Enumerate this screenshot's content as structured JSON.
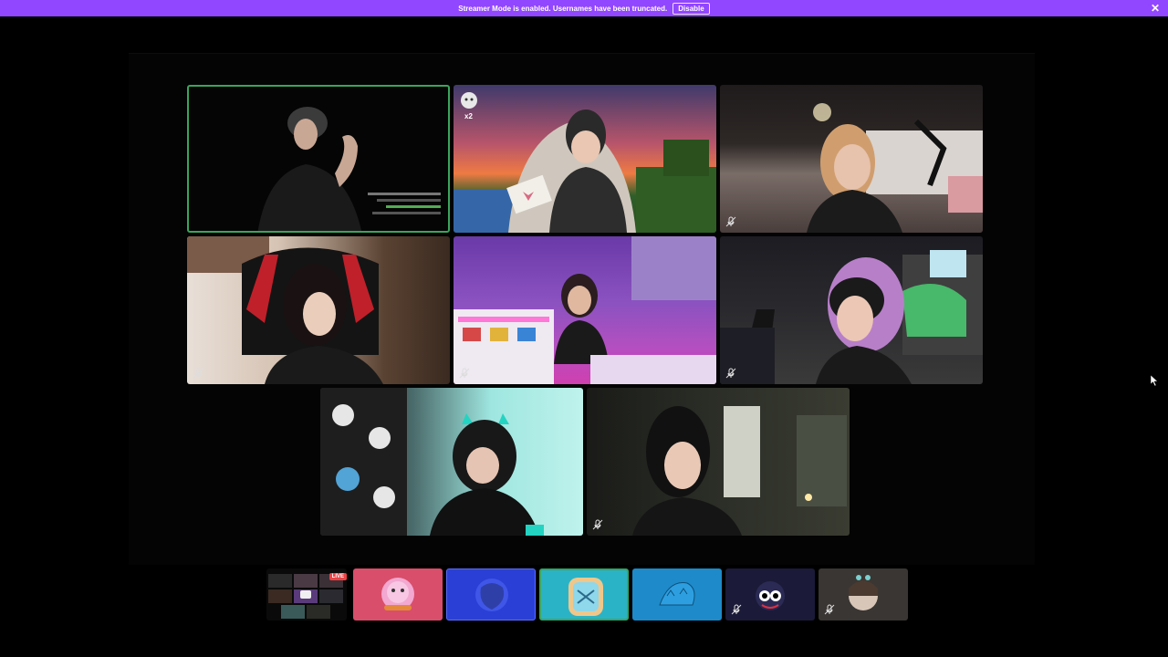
{
  "banner": {
    "text": "Streamer Mode is enabled. Usernames have been truncated.",
    "button_label": "Disable",
    "close_glyph": "✕",
    "color": "#9146ff"
  },
  "stage": {
    "tiles": [
      {
        "id": "tile-1",
        "speaking": true,
        "muted": false
      },
      {
        "id": "tile-2",
        "speaking": false,
        "muted": false,
        "emote_count": "x2"
      },
      {
        "id": "tile-3",
        "speaking": false,
        "muted": true
      },
      {
        "id": "tile-4",
        "speaking": false,
        "muted": true
      },
      {
        "id": "tile-5",
        "speaking": false,
        "muted": true
      },
      {
        "id": "tile-6",
        "speaking": false,
        "muted": true
      },
      {
        "id": "tile-7",
        "speaking": false,
        "muted": true
      },
      {
        "id": "tile-8",
        "speaking": false,
        "muted": true
      }
    ],
    "speaking_color": "#3ba55c"
  },
  "participants_strip": {
    "live_label": "LIVE",
    "items": [
      {
        "name": "stream-preview",
        "live": true
      },
      {
        "name": "pink-avatar",
        "color": "#d94e6b"
      },
      {
        "name": "blue-avatar",
        "color": "#2a3fd6"
      },
      {
        "name": "toast-avatar",
        "color": "#2ab3c7",
        "selected": true
      },
      {
        "name": "sky-avatar",
        "color": "#1e8ac9"
      },
      {
        "name": "dark-avatar",
        "color": "#1b1a38",
        "muted": true
      },
      {
        "name": "brown-avatar",
        "color": "#3a3633",
        "muted": true
      }
    ]
  }
}
